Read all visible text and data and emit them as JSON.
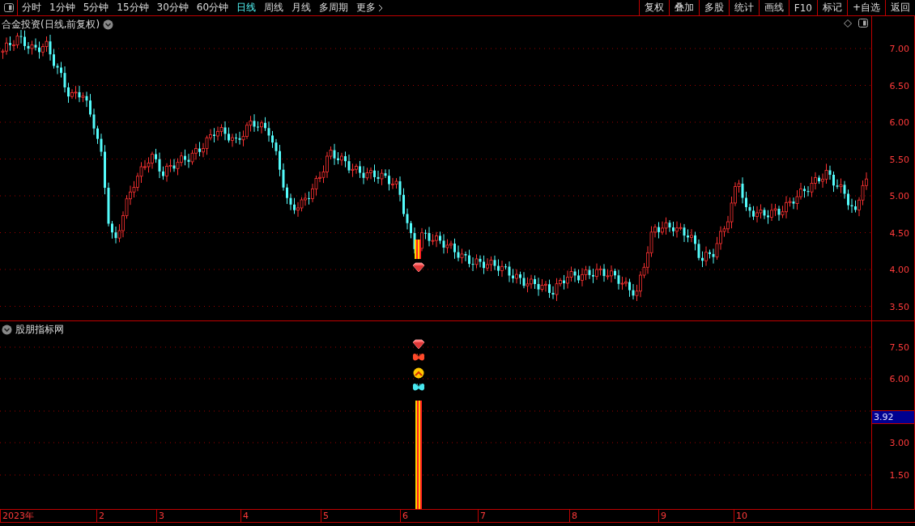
{
  "toolbar": {
    "periods": [
      {
        "label": "分时",
        "selected": false
      },
      {
        "label": "1分钟",
        "selected": false
      },
      {
        "label": "5分钟",
        "selected": false
      },
      {
        "label": "15分钟",
        "selected": false
      },
      {
        "label": "30分钟",
        "selected": false
      },
      {
        "label": "60分钟",
        "selected": false
      },
      {
        "label": "日线",
        "selected": true
      },
      {
        "label": "周线",
        "selected": false
      },
      {
        "label": "月线",
        "selected": false
      },
      {
        "label": "多周期",
        "selected": false
      },
      {
        "label": "更多",
        "selected": false
      }
    ],
    "buttons": [
      "复权",
      "叠加",
      "多股",
      "统计",
      "画线",
      "F10",
      "标记",
      "+自选",
      "返回"
    ]
  },
  "main_chart": {
    "title": "合金投资(日线,前复权)",
    "y_ticks": [
      "7.00",
      "6.50",
      "6.00",
      "5.50",
      "5.00",
      "4.50",
      "4.00",
      "3.50"
    ]
  },
  "indicator_panel": {
    "title": "股朋指标网",
    "y_ticks": [
      "7.50",
      "6.00",
      "3.00",
      "1.50"
    ],
    "current_value": "3.92"
  },
  "date_axis": [
    "2023年",
    "2",
    "3",
    "4",
    "5",
    "6",
    "7",
    "8",
    "9",
    "10"
  ]
}
